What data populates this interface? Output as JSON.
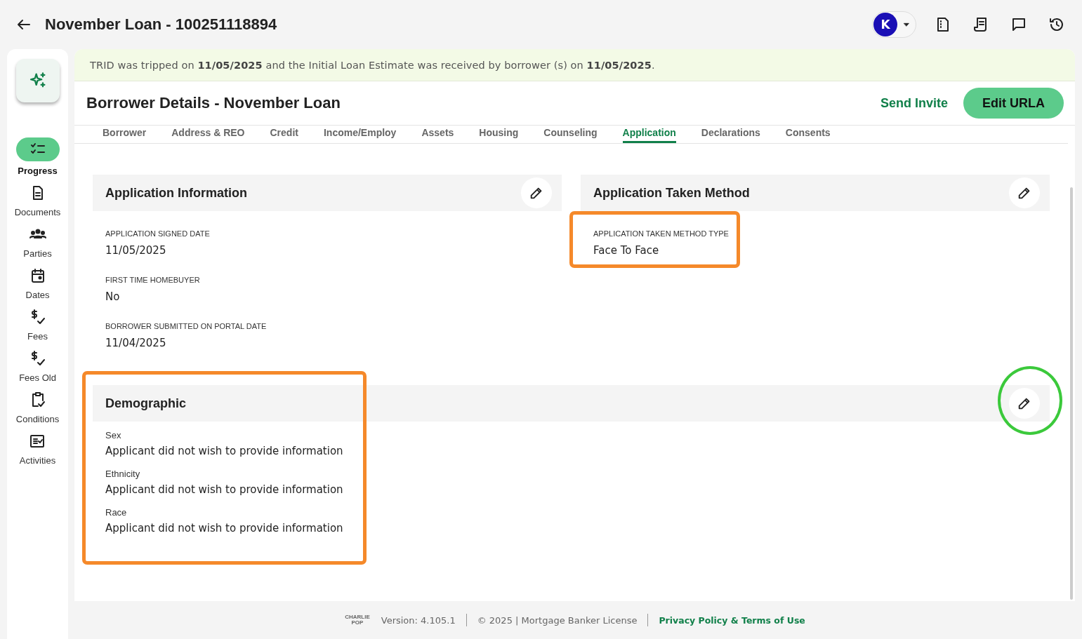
{
  "header": {
    "title": "November Loan - 100251118894",
    "avatar": "K"
  },
  "sidebar": {
    "items": [
      {
        "label": "Progress",
        "selected": true
      },
      {
        "label": "Documents",
        "selected": false
      },
      {
        "label": "Parties",
        "selected": false
      },
      {
        "label": "Dates",
        "selected": false
      },
      {
        "label": "Fees",
        "selected": false
      },
      {
        "label": "Fees Old",
        "selected": false
      },
      {
        "label": "Conditions",
        "selected": false
      },
      {
        "label": "Activities",
        "selected": false
      }
    ]
  },
  "banner": {
    "text": "TRID was tripped on **11/05/2025** and the Initial Loan Estimate was received by borrower (s) on **11/05/2025**."
  },
  "page": {
    "title": "Borrower Details - November Loan",
    "actions": [
      {
        "label": "Send Invite",
        "kind": "link"
      },
      {
        "label": "Edit URLA",
        "kind": "primary"
      }
    ]
  },
  "tabs": [
    {
      "label": "Borrower",
      "selected": false
    },
    {
      "label": "Address & REO",
      "selected": false
    },
    {
      "label": "Credit",
      "selected": false
    },
    {
      "label": "Income/Employ",
      "selected": false
    },
    {
      "label": "Assets",
      "selected": false
    },
    {
      "label": "Housing",
      "selected": false
    },
    {
      "label": "Counseling",
      "selected": false
    },
    {
      "label": "Application",
      "selected": true
    },
    {
      "label": "Declarations",
      "selected": false
    },
    {
      "label": "Consents",
      "selected": false
    }
  ],
  "sections": [
    {
      "title": "Application Information",
      "kind": "half",
      "highlighted": false,
      "edit_highlighted": false,
      "fields": [
        {
          "label": "APPLICATION SIGNED DATE",
          "value": "11/05/2025",
          "highlighted": false
        },
        {
          "label": "FIRST TIME HOMEBUYER",
          "value": "No",
          "highlighted": false
        },
        {
          "label": "BORROWER SUBMITTED ON PORTAL DATE",
          "value": "11/04/2025",
          "highlighted": false
        }
      ]
    },
    {
      "title": "Application Taken Method",
      "kind": "half",
      "highlighted": false,
      "edit_highlighted": false,
      "fields": [
        {
          "label": "APPLICATION TAKEN METHOD TYPE",
          "value": "Face To Face",
          "highlighted": true
        }
      ]
    },
    {
      "title": "Demographic",
      "kind": "wide",
      "highlighted": true,
      "edit_highlighted": true,
      "fields": [
        {
          "label": "Sex",
          "value": "Applicant did not wish to provide information",
          "highlighted": false
        },
        {
          "label": "Ethnicity",
          "value": "Applicant did not wish to provide information",
          "highlighted": false
        },
        {
          "label": "Race",
          "value": "Applicant did not wish to provide information",
          "highlighted": false
        }
      ]
    }
  ],
  "footer": {
    "logo_lines": [
      "CHARLIE",
      "POP"
    ],
    "version": "Version: 4.105.1",
    "copyright": "© 2025 | Mortgage Banker License",
    "link": "Privacy Policy & Terms of Use"
  }
}
